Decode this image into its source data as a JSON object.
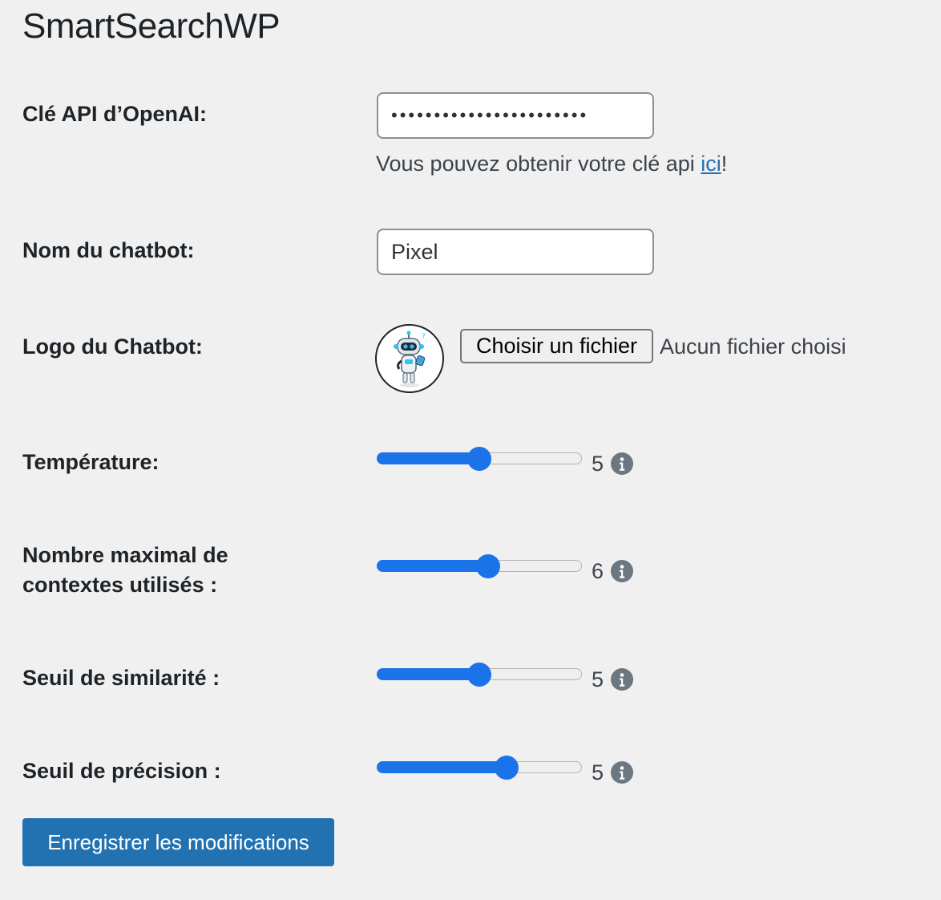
{
  "page": {
    "title": "SmartSearchWP"
  },
  "api_key": {
    "label": "Clé API d’OpenAI:",
    "value": "•••••••••••••••••••••••",
    "help_prefix": "Vous pouvez obtenir votre clé api ",
    "help_link": "ici",
    "help_suffix": "!"
  },
  "chatbot_name": {
    "label": "Nom du chatbot:",
    "value": "Pixel"
  },
  "chatbot_logo": {
    "label": "Logo du Chatbot:",
    "file_button": "Choisir un fichier",
    "file_status": "Aucun fichier choisi"
  },
  "sliders": [
    {
      "label": "Température:",
      "value": "5",
      "fill_fraction": 0.5
    },
    {
      "label": "Nombre maximal de contextes utilisés :",
      "value": "6",
      "fill_fraction": 0.55
    },
    {
      "label": "Seuil de similarité :",
      "value": "5",
      "fill_fraction": 0.5
    },
    {
      "label": "Seuil de précision :",
      "value": "5",
      "fill_fraction": 0.65
    }
  ],
  "save_button": {
    "label": "Enregistrer les modifications"
  },
  "colors": {
    "accent": "#1a73e8",
    "button": "#2271b1",
    "info_icon": "#6c7781",
    "background": "#f0f0f1"
  },
  "icons": {
    "info": "info-icon",
    "logo": "robot-avatar-icon"
  }
}
